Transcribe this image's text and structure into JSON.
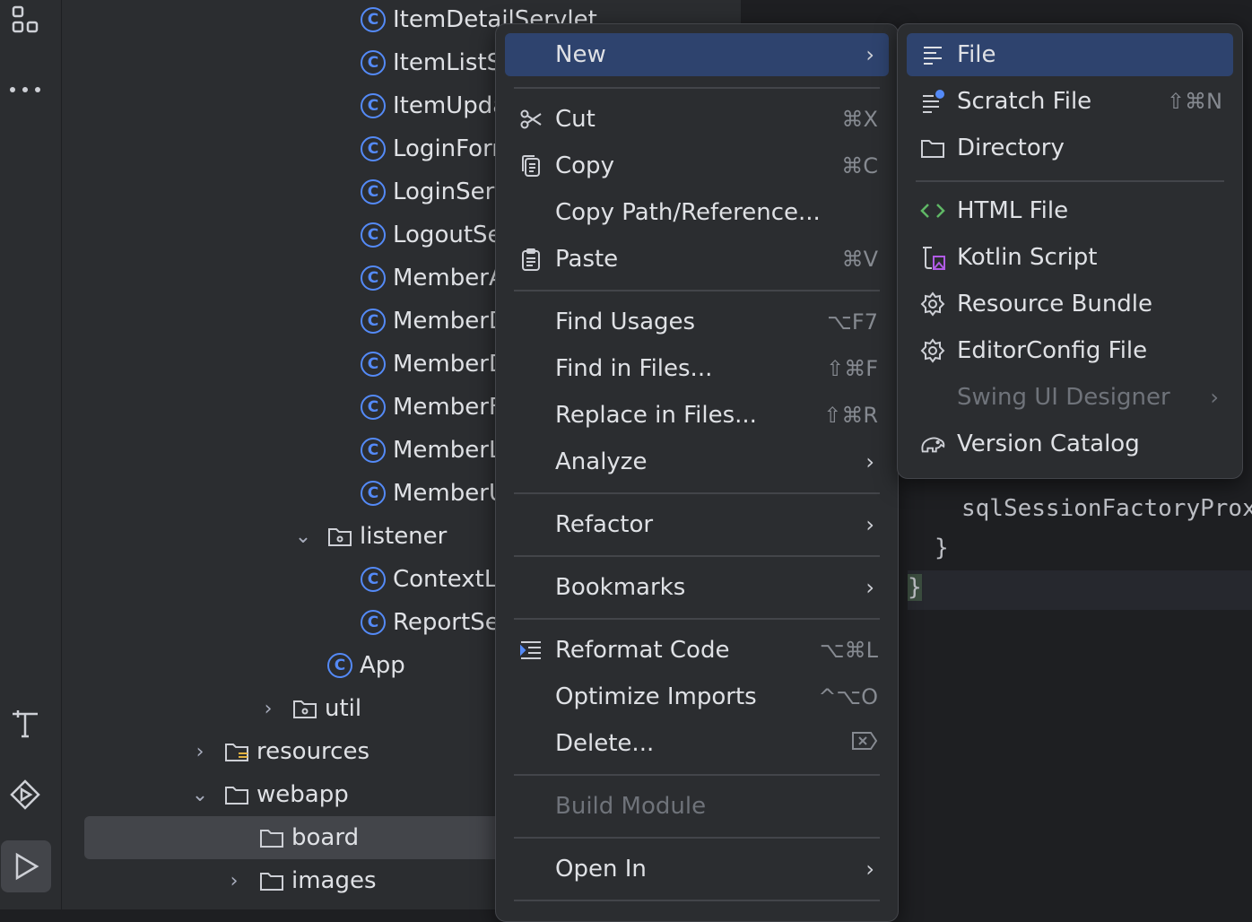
{
  "tree": {
    "items": [
      {
        "label": "ItemDetailServlet",
        "type": "class"
      },
      {
        "label": "ItemListS",
        "type": "class"
      },
      {
        "label": "ItemUpda",
        "type": "class"
      },
      {
        "label": "LoginForr",
        "type": "class"
      },
      {
        "label": "LoginSer",
        "type": "class"
      },
      {
        "label": "LogoutSe",
        "type": "class"
      },
      {
        "label": "MemberA",
        "type": "class"
      },
      {
        "label": "MemberD",
        "type": "class"
      },
      {
        "label": "MemberD",
        "type": "class"
      },
      {
        "label": "MemberF",
        "type": "class"
      },
      {
        "label": "MemberL",
        "type": "class"
      },
      {
        "label": "MemberU",
        "type": "class"
      },
      {
        "label": "listener",
        "type": "package"
      },
      {
        "label": "ContextL",
        "type": "class"
      },
      {
        "label": "ReportSe",
        "type": "class"
      },
      {
        "label": "App",
        "type": "class"
      },
      {
        "label": "util",
        "type": "package"
      },
      {
        "label": "resources",
        "type": "folder"
      },
      {
        "label": "webapp",
        "type": "folder"
      },
      {
        "label": "board",
        "type": "folder",
        "selected": true
      },
      {
        "label": "images",
        "type": "folder"
      }
    ]
  },
  "editor": {
    "lines": [
      {
        "text": "sqlSessionFactoryProxy"
      },
      {
        "text": "}"
      },
      {
        "text": "}"
      }
    ]
  },
  "context_menu": {
    "new": {
      "label": "New",
      "has_submenu": true
    },
    "cut": {
      "label": "Cut",
      "shortcut": "⌘X",
      "icon": "scissors-icon"
    },
    "copy": {
      "label": "Copy",
      "shortcut": "⌘C",
      "icon": "copy-icon"
    },
    "copy_path": {
      "label": "Copy Path/Reference..."
    },
    "paste": {
      "label": "Paste",
      "shortcut": "⌘V",
      "icon": "clipboard-icon"
    },
    "find_usages": {
      "label": "Find Usages",
      "shortcut": "⌥F7"
    },
    "find_in_files": {
      "label": "Find in Files...",
      "shortcut": "⇧⌘F"
    },
    "replace_in_files": {
      "label": "Replace in Files...",
      "shortcut": "⇧⌘R"
    },
    "analyze": {
      "label": "Analyze",
      "has_submenu": true
    },
    "refactor": {
      "label": "Refactor",
      "has_submenu": true
    },
    "bookmarks": {
      "label": "Bookmarks",
      "has_submenu": true
    },
    "reformat_code": {
      "label": "Reformat Code",
      "shortcut": "⌥⌘L",
      "icon": "reformat-icon"
    },
    "optimize_imports": {
      "label": "Optimize Imports",
      "shortcut": "^⌥O"
    },
    "delete": {
      "label": "Delete...",
      "icon_shortcut": "delete-key-icon"
    },
    "build_module": {
      "label": "Build Module",
      "disabled": true
    },
    "open_in": {
      "label": "Open In",
      "has_submenu": true
    }
  },
  "new_submenu": {
    "file": {
      "label": "File",
      "icon": "file-lines-icon"
    },
    "scratch_file": {
      "label": "Scratch File",
      "shortcut": "⇧⌘N",
      "icon": "scratch-file-icon"
    },
    "directory": {
      "label": "Directory",
      "icon": "folder-icon"
    },
    "html_file": {
      "label": "HTML File",
      "icon": "html-icon"
    },
    "kotlin_script": {
      "label": "Kotlin Script",
      "icon": "kotlin-script-icon"
    },
    "resource_bundle": {
      "label": "Resource Bundle",
      "icon": "gear-icon"
    },
    "editorconfig_file": {
      "label": "EditorConfig File",
      "icon": "gear-icon"
    },
    "swing_ui_designer": {
      "label": "Swing UI Designer",
      "disabled": true,
      "has_submenu": true
    },
    "version_catalog": {
      "label": "Version Catalog",
      "icon": "elephant-icon"
    }
  },
  "colors": {
    "accent": "#548af7",
    "highlight": "#2e436e",
    "panel": "#2b2d30",
    "editor_bg": "#1e1f22"
  }
}
